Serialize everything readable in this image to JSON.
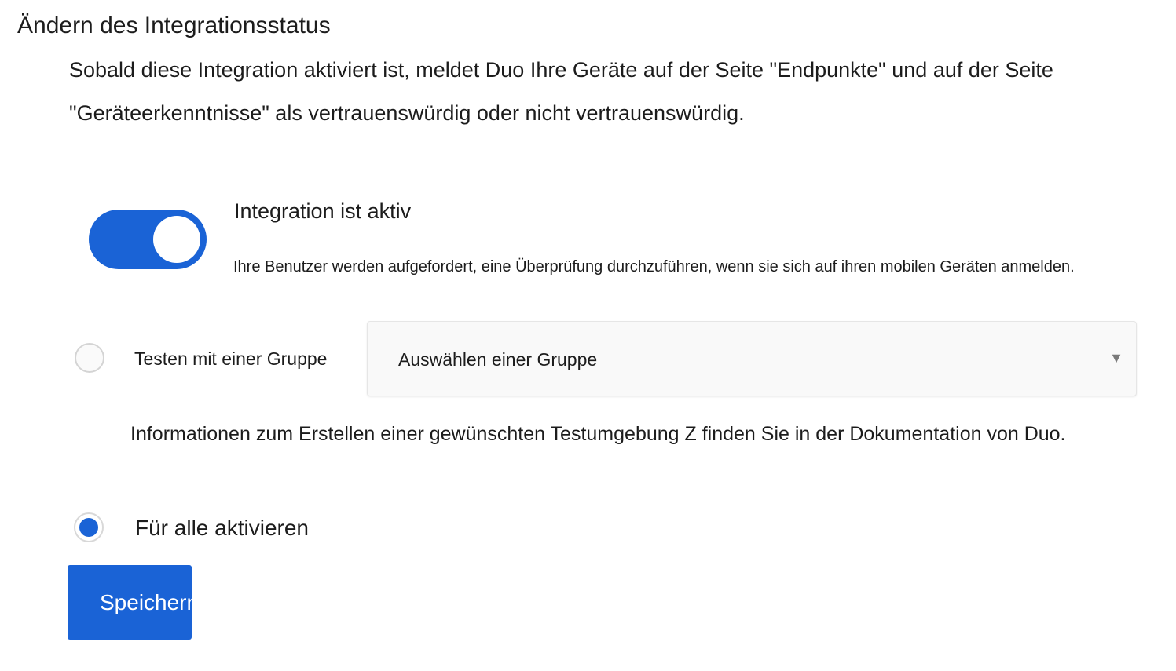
{
  "page": {
    "title": "Ändern des Integrationsstatus",
    "description": "Sobald diese Integration aktiviert ist, meldet Duo Ihre Geräte auf der Seite \"Endpunkte\" und auf der Seite \"Geräteerkenntnisse\" als vertrauenswürdig oder nicht vertrauenswürdig."
  },
  "integration_toggle": {
    "state": "on",
    "title": "Integration ist aktiv",
    "description": "Ihre Benutzer werden aufgefordert, eine Überprüfung durchzuführen, wenn sie sich auf ihren mobilen Geräten anmelden."
  },
  "test_group_option": {
    "selected": false,
    "label": "Testen mit einer Gruppe",
    "group_select_value": "Auswählen einer Gruppe",
    "info": "Informationen zum Erstellen einer gewünschten Testumgebung Z finden Sie in der Dokumentation von Duo."
  },
  "all_option": {
    "selected": true,
    "label": "Für alle aktivieren"
  },
  "save_button": {
    "label": "Speichern"
  },
  "colors": {
    "accent": "#1a63d6",
    "text": "#1c1c1c",
    "select_background": "#f9f9f9"
  },
  "icons": {
    "select_caret": "caret-down-icon"
  }
}
